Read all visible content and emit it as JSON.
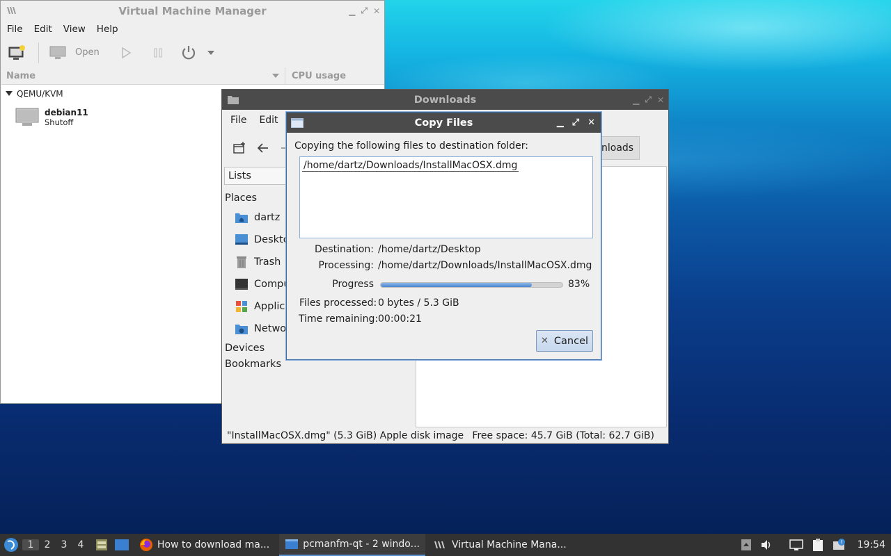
{
  "colors": {
    "accent": "#4a86cf",
    "titlebar_dark": "#4b4b4b",
    "taskbar": "#323232"
  },
  "vmm": {
    "title": "Virtual Machine Manager",
    "menu": [
      "File",
      "Edit",
      "View",
      "Help"
    ],
    "toolbar": {
      "open_label": "Open",
      "icons": [
        "new-vm-icon",
        "monitor-icon",
        "run-icon",
        "pause-icon",
        "power-icon",
        "dropdown-icon"
      ]
    },
    "columns": {
      "name": "Name",
      "cpu": "CPU usage"
    },
    "group": "QEMU/KVM",
    "vm": {
      "name": "debian11",
      "state": "Shutoff"
    }
  },
  "downloads": {
    "title": "Downloads",
    "menu": [
      "File",
      "Edit"
    ],
    "path_tail": "nloads",
    "view_label": "Lists",
    "places_header": "Places",
    "places": [
      {
        "label": "dartz",
        "icon": "home-folder-icon"
      },
      {
        "label": "Deskto",
        "icon": "desktop-icon"
      },
      {
        "label": "Trash",
        "icon": "trash-icon"
      },
      {
        "label": "Compu",
        "icon": "computer-icon"
      },
      {
        "label": "Applica",
        "icon": "applications-icon"
      },
      {
        "label": "Netwo",
        "icon": "network-icon"
      }
    ],
    "devices_header": "Devices",
    "bookmarks_header": "Bookmarks",
    "status_left": "\"InstallMacOSX.dmg\" (5.3 GiB) Apple disk image",
    "status_right": "Free space: 45.7 GiB (Total: 62.7 GiB)"
  },
  "copy": {
    "title": "Copy Files",
    "heading": "Copying the following files to destination folder:",
    "files": [
      "/home/dartz/Downloads/InstallMacOSX.dmg"
    ],
    "destination_label": "Destination:",
    "destination": "/home/dartz/Desktop",
    "processing_label": "Processing:",
    "processing": "/home/dartz/Downloads/InstallMacOSX.dmg",
    "progress_label": "Progress",
    "progress_percent": 83,
    "progress_text": "83%",
    "files_processed_label": "Files processed:",
    "files_processed": "0 bytes / 5.3 GiB",
    "time_remaining_label": "Time remaining:",
    "time_remaining": "00:00:21",
    "cancel_label": "Cancel"
  },
  "taskbar": {
    "workspaces": [
      "1",
      "2",
      "3",
      "4"
    ],
    "active_workspace": "1",
    "tasks": [
      {
        "label": "How to download ma...",
        "icon": "firefox-icon"
      },
      {
        "label": "pcmanfm-qt - 2 windo...",
        "icon": "folder-icon"
      },
      {
        "label": "Virtual Machine Mana...",
        "icon": "virt-manager-icon"
      }
    ],
    "clock": "19:54"
  }
}
